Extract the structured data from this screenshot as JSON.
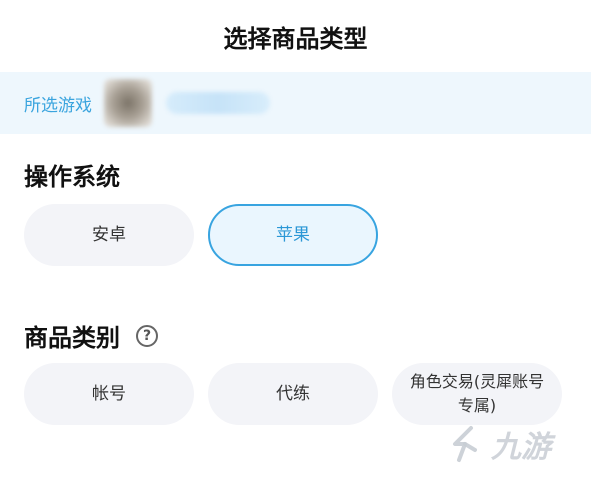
{
  "header": {
    "title": "选择商品类型"
  },
  "game": {
    "label": "所选游戏"
  },
  "os": {
    "title": "操作系统",
    "options": [
      {
        "label": "安卓",
        "selected": false
      },
      {
        "label": "苹果",
        "selected": true
      }
    ]
  },
  "category": {
    "title": "商品类别",
    "help_icon": "question-circle-icon",
    "options": [
      {
        "label": "帐号"
      },
      {
        "label": "代练"
      },
      {
        "label": "角色交易(灵犀账号专属)"
      }
    ]
  },
  "watermark": {
    "text": "九游"
  },
  "colors": {
    "accent": "#38a4e0",
    "pill_bg": "#f3f4f8",
    "game_bar_bg": "#eef7fd"
  }
}
